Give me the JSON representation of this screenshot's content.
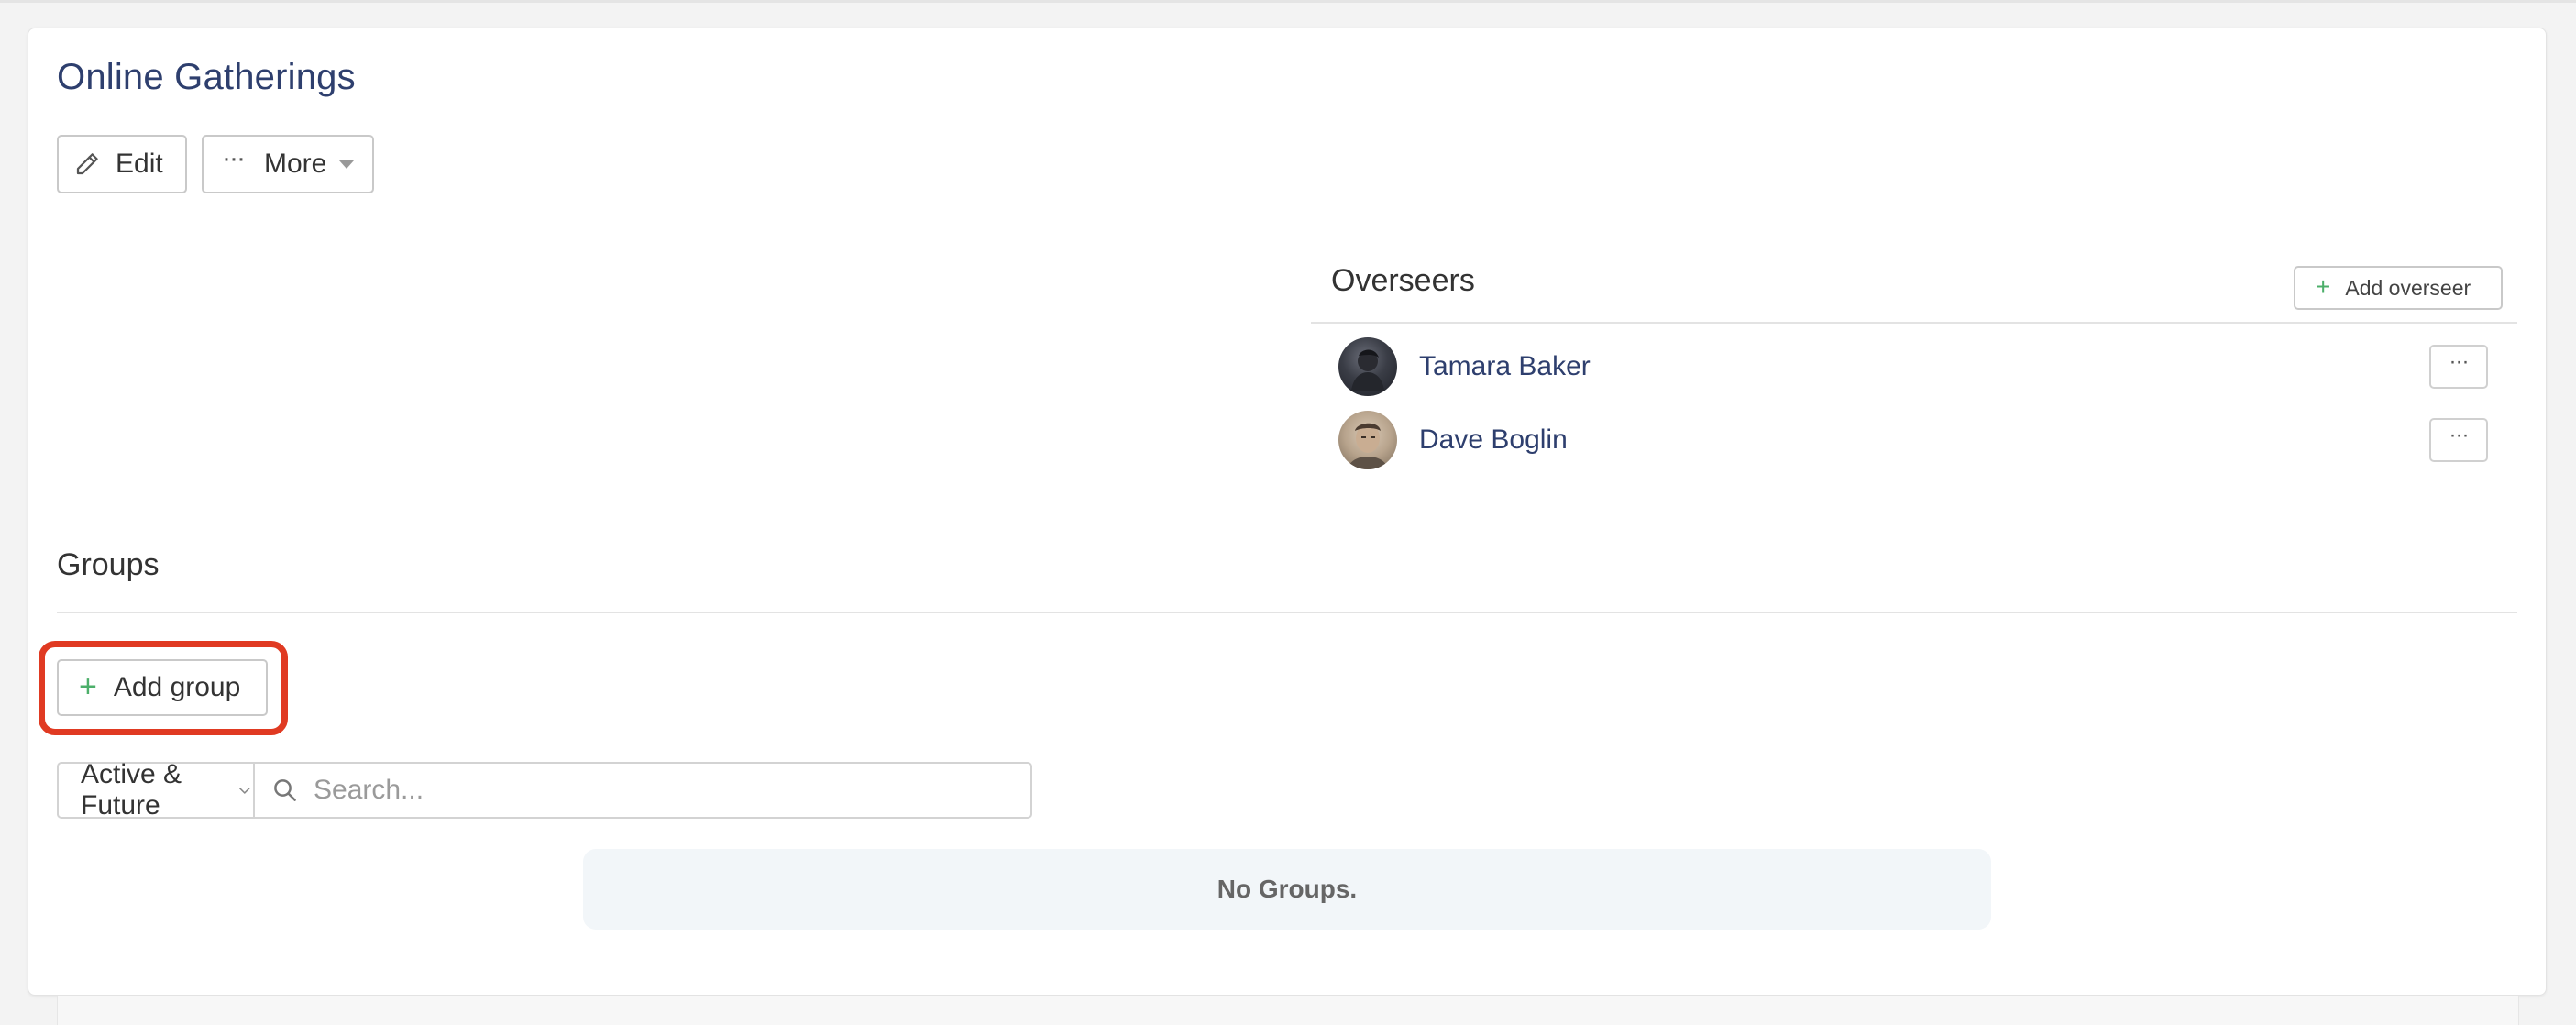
{
  "page": {
    "title": "Online Gatherings",
    "edit_label": "Edit",
    "more_label": "More"
  },
  "overseers": {
    "heading": "Overseers",
    "add_label": "Add overseer",
    "people": [
      {
        "name": "Tamara Baker",
        "menu": "···"
      },
      {
        "name": "Dave Boglin",
        "menu": "···"
      }
    ]
  },
  "groups": {
    "heading": "Groups",
    "add_label": "Add group",
    "filter": {
      "selected": "Active & Future"
    },
    "search": {
      "placeholder": "Search...",
      "value": ""
    },
    "empty_message": "No Groups."
  },
  "colors": {
    "accent_text": "#2e3f6e",
    "plus_green": "#4caf6a",
    "highlight_red": "#e03a22"
  }
}
